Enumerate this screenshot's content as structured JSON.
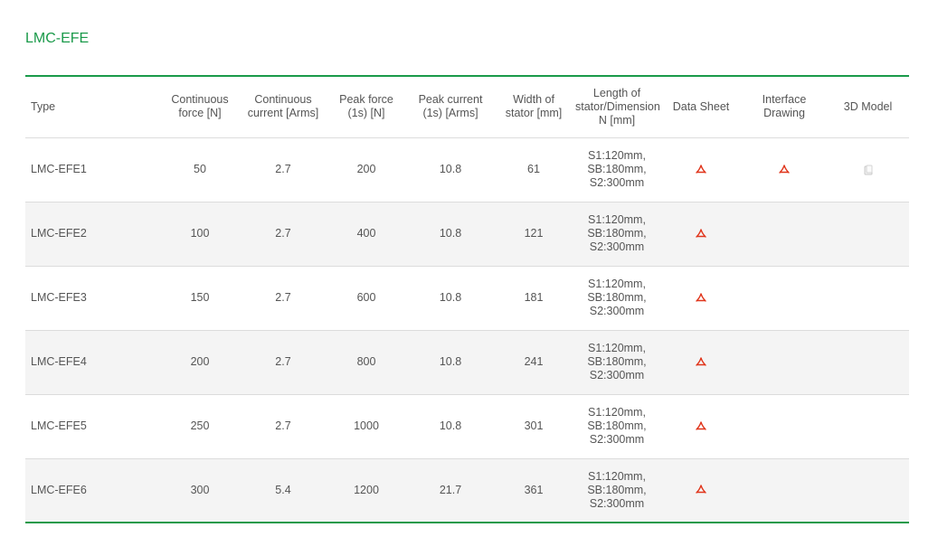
{
  "title": "LMC-EFE",
  "headers": {
    "type": "Type",
    "cont_force": [
      "Continuous",
      "force [N]"
    ],
    "cont_current": [
      "Continuous",
      "current [Arms]"
    ],
    "peak_force": [
      "Peak force",
      "(1s) [N]"
    ],
    "peak_current": [
      "Peak current",
      "(1s) [Arms]"
    ],
    "width": [
      "Width of",
      "stator [mm]"
    ],
    "length": [
      "Length of",
      "stator/Dimension",
      "N [mm]"
    ],
    "datasheet": "Data Sheet",
    "interface": [
      "Interface",
      "Drawing"
    ],
    "model3d": "3D Model"
  },
  "rows": [
    {
      "type": "LMC-EFE1",
      "cont_force": "50",
      "cont_current": "2.7",
      "peak_force": "200",
      "peak_current": "10.8",
      "width": "61",
      "dim": [
        "S1:120mm,",
        "SB:180mm,",
        "S2:300mm"
      ]
    },
    {
      "type": "LMC-EFE2",
      "cont_force": "100",
      "cont_current": "2.7",
      "peak_force": "400",
      "peak_current": "10.8",
      "width": "121",
      "dim": [
        "S1:120mm,",
        "SB:180mm,",
        "S2:300mm"
      ]
    },
    {
      "type": "LMC-EFE3",
      "cont_force": "150",
      "cont_current": "2.7",
      "peak_force": "600",
      "peak_current": "10.8",
      "width": "181",
      "dim": [
        "S1:120mm,",
        "SB:180mm,",
        "S2:300mm"
      ]
    },
    {
      "type": "LMC-EFE4",
      "cont_force": "200",
      "cont_current": "2.7",
      "peak_force": "800",
      "peak_current": "10.8",
      "width": "241",
      "dim": [
        "S1:120mm,",
        "SB:180mm,",
        "S2:300mm"
      ]
    },
    {
      "type": "LMC-EFE5",
      "cont_force": "250",
      "cont_current": "2.7",
      "peak_force": "1000",
      "peak_current": "10.8",
      "width": "301",
      "dim": [
        "S1:120mm,",
        "SB:180mm,",
        "S2:300mm"
      ]
    },
    {
      "type": "LMC-EFE6",
      "cont_force": "300",
      "cont_current": "5.4",
      "peak_force": "1200",
      "peak_current": "21.7",
      "width": "361",
      "dim": [
        "S1:120mm,",
        "SB:180mm,",
        "S2:300mm"
      ]
    }
  ],
  "icons": {
    "datasheet": "pdf-icon",
    "interface": "pdf-icon",
    "model3d": "3d-model-icon"
  },
  "colors": {
    "accent": "#1a9a4a",
    "pdf": "#e0351b",
    "row_alt": "#f4f4f4"
  }
}
